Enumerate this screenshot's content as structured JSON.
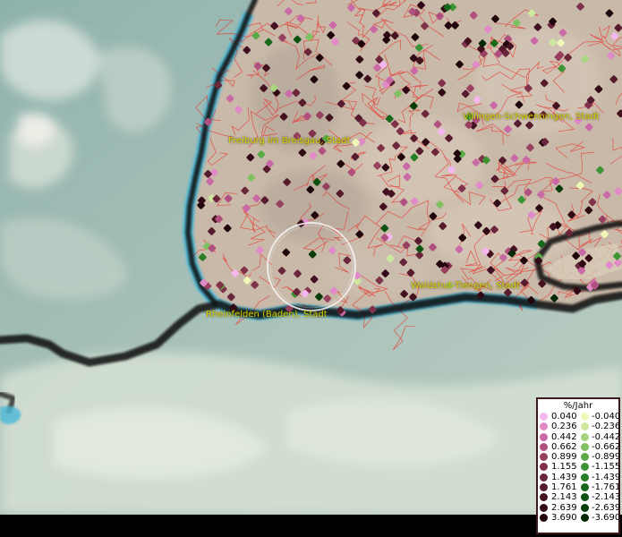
{
  "map": {
    "labels": [
      {
        "id": "freiburg",
        "text": "Freiburg im Breisgau, Stadt"
      },
      {
        "id": "villingen",
        "text": "Villingen-Schwenningen, Stadt"
      },
      {
        "id": "waldshut",
        "text": "Waldshut-Tiengen, Stadt"
      },
      {
        "id": "rheinfelden",
        "text": "Rheinfelden (Baden), Stadt"
      }
    ]
  },
  "legend": {
    "title": "%/Jahr",
    "positive": [
      {
        "value": "0.040",
        "color": "#f4b8ee"
      },
      {
        "value": "0.236",
        "color": "#e08ac8"
      },
      {
        "value": "0.442",
        "color": "#c96aa6"
      },
      {
        "value": "0.662",
        "color": "#b0507f"
      },
      {
        "value": "0.899",
        "color": "#98405f"
      },
      {
        "value": "1.155",
        "color": "#80324a"
      },
      {
        "value": "1.439",
        "color": "#6a263a"
      },
      {
        "value": "1.761",
        "color": "#561b2c"
      },
      {
        "value": "2.143",
        "color": "#431120"
      },
      {
        "value": "2.639",
        "color": "#310a15"
      },
      {
        "value": "3.690",
        "color": "#20050b"
      }
    ],
    "negative": [
      {
        "value": "-0.040",
        "color": "#f0f8b8"
      },
      {
        "value": "-0.236",
        "color": "#cfe8a0"
      },
      {
        "value": "-0.442",
        "color": "#a8d480"
      },
      {
        "value": "-0.662",
        "color": "#7fc060"
      },
      {
        "value": "-0.899",
        "color": "#5aaa48"
      },
      {
        "value": "-1.155",
        "color": "#3d9434"
      },
      {
        "value": "-1.439",
        "color": "#277e26"
      },
      {
        "value": "-1.761",
        "color": "#17681a"
      },
      {
        "value": "-2.143",
        "color": "#0c5210"
      },
      {
        "value": "-2.639",
        "color": "#053c08"
      },
      {
        "value": "-3.690",
        "color": "#022804"
      }
    ]
  }
}
